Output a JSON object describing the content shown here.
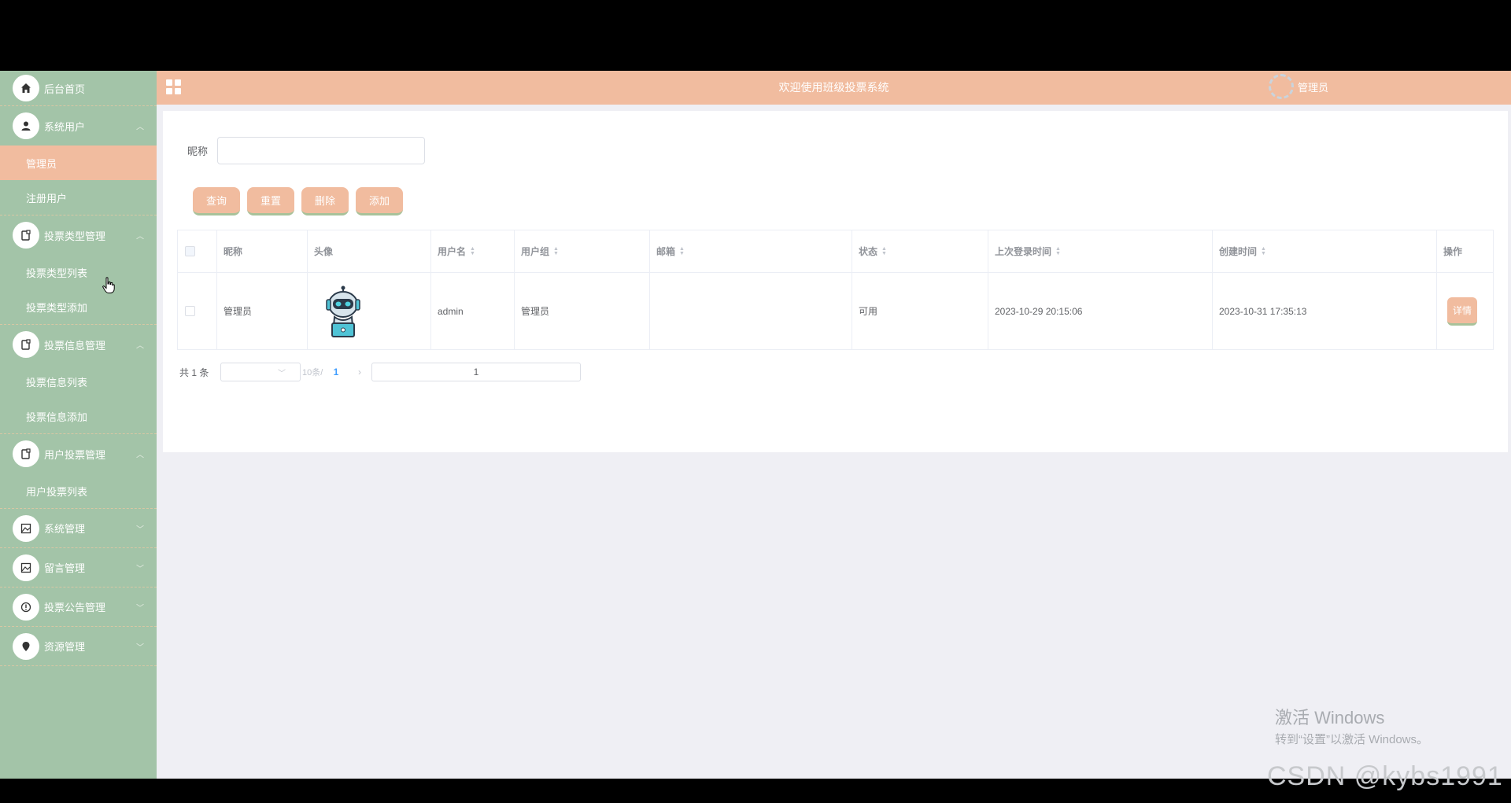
{
  "sidebar": {
    "items": [
      {
        "label": "后台首页",
        "icon": "home-icon"
      },
      {
        "label": "系统用户",
        "icon": "user-icon",
        "children": [
          {
            "label": "管理员",
            "active": true
          },
          {
            "label": "注册用户"
          }
        ]
      },
      {
        "label": "投票类型管理",
        "icon": "doc-icon",
        "children": [
          {
            "label": "投票类型列表"
          },
          {
            "label": "投票类型添加"
          }
        ]
      },
      {
        "label": "投票信息管理",
        "icon": "doc-icon",
        "children": [
          {
            "label": "投票信息列表"
          },
          {
            "label": "投票信息添加"
          }
        ]
      },
      {
        "label": "用户投票管理",
        "icon": "doc-icon",
        "children": [
          {
            "label": "用户投票列表"
          }
        ]
      },
      {
        "label": "系统管理",
        "icon": "image-icon"
      },
      {
        "label": "留言管理",
        "icon": "image-icon"
      },
      {
        "label": "投票公告管理",
        "icon": "info-icon"
      },
      {
        "label": "资源管理",
        "icon": "location-icon"
      }
    ]
  },
  "header": {
    "title": "欢迎使用班级投票系统",
    "user_name": "管理员"
  },
  "search": {
    "label": "昵称",
    "value": "",
    "placeholder": ""
  },
  "buttons": {
    "query": "查询",
    "reset": "重置",
    "delete": "删除",
    "add": "添加"
  },
  "table": {
    "columns": [
      "昵称",
      "头像",
      "用户名",
      "用户组",
      "邮箱",
      "状态",
      "上次登录时间",
      "创建时间",
      "操作"
    ],
    "rows": [
      {
        "nickname": "管理员",
        "username": "admin",
        "group": "管理员",
        "email": "",
        "status": "可用",
        "last_login": "2023-10-29 20:15:06",
        "created": "2023-10-31 17:35:13",
        "action": "详情"
      }
    ]
  },
  "pagination": {
    "total": "共 1 条",
    "page_size_text": "10条/",
    "current_page": "1",
    "jump_value": "1"
  },
  "watermarks": {
    "windows_line1": "激活 Windows",
    "windows_line2": "转到“设置”以激活 Windows。",
    "csdn": "CSDN @kybs1991"
  },
  "colors": {
    "sidebar_bg": "#a3c4a8",
    "accent": "#f1bc9f",
    "page_bg": "#efeff4"
  }
}
